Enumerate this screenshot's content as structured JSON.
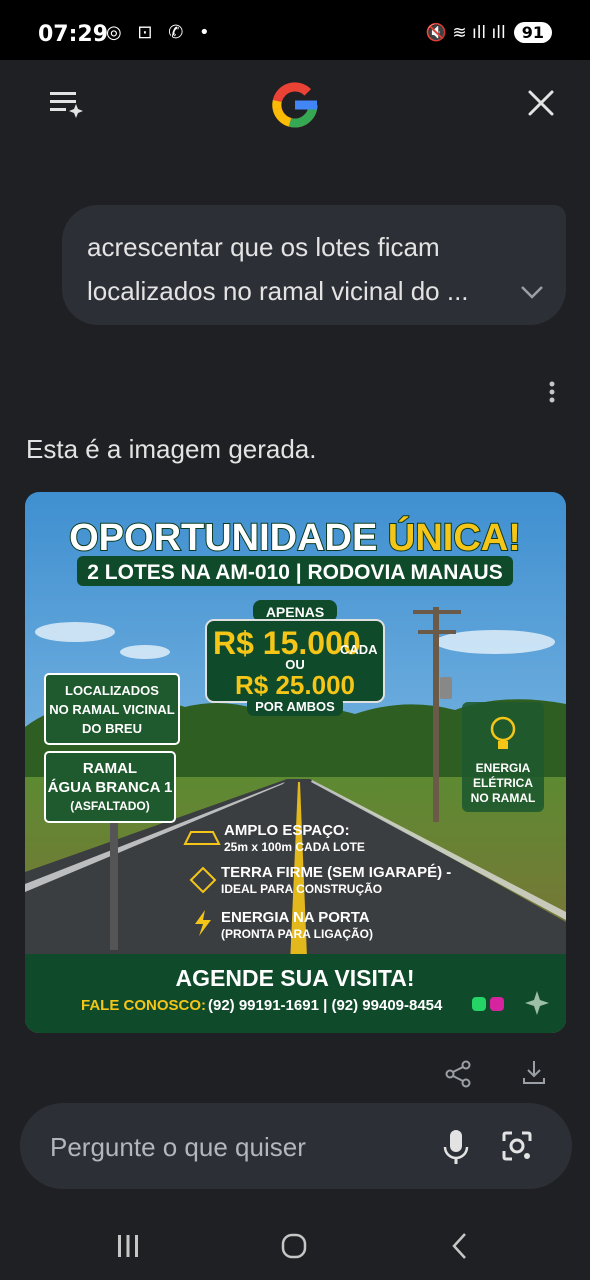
{
  "status_bar": {
    "time": "07:29",
    "left_icons": [
      "chrome-icon",
      "screenshot-icon",
      "whatsapp-icon",
      "dot-icon"
    ],
    "left_glyphs": "◎ ⊡ ✆ •",
    "right_glyphs": "🔇 ≋ ıll ıll",
    "battery": "91"
  },
  "header": {
    "menu_icon": "history-menu-icon",
    "logo": "google-logo",
    "close_icon": "close-icon"
  },
  "user_message": {
    "line1": "acrescentar que os lotes ficam",
    "line2": "localizados no ramal vicinal do ..."
  },
  "response": {
    "text": "Esta é a imagem gerada."
  },
  "generated_image": {
    "title_part1": "OPORTUNIDADE",
    "title_part2": "ÚNICA!",
    "subtitle": "2 LOTES NA AM-010 | RODOVIA MANAUS",
    "price_label_top": "APENAS",
    "price_main": "R$ 15.000",
    "price_main_suffix": "CADA",
    "price_or": "OU",
    "price_both": "R$ 25.000",
    "price_both_label": "POR AMBOS",
    "sign_location": [
      "LOCALIZADOS",
      "NO RAMAL VICINAL",
      "DO BREU"
    ],
    "sign_ramal": [
      "RAMAL",
      "ÁGUA BRANCA 1",
      "(ASFALTADO)"
    ],
    "energy_sign": [
      "ENERGIA",
      "ELÉTRICA",
      "NO RAMAL"
    ],
    "features": [
      {
        "title": "AMPLO ESPAÇO:",
        "detail": "25m x 100m CADA LOTE"
      },
      {
        "title": "TERRA FIRME (SEM IGARAPÉ) -",
        "detail": "IDEAL PARA CONSTRUÇÃO"
      },
      {
        "title": "ENERGIA NA PORTA",
        "detail": "(PRONTA PARA LIGAÇÃO)"
      }
    ],
    "cta": "AGENDE SUA VISITA!",
    "contact_label": "FALE CONOSCO:",
    "contact_numbers": "(92) 99191-1691 | (92) 99409-8454",
    "colors": {
      "sky": "#5aa7dc",
      "dark_green": "#0f4a2a",
      "yellow": "#f5c518",
      "road": "#3b3e41"
    }
  },
  "actions": {
    "share_icon": "share-icon",
    "download_icon": "download-icon"
  },
  "input": {
    "placeholder": "Pergunte o que quiser",
    "mic_icon": "microphone-icon",
    "lens_icon": "google-lens-icon"
  },
  "nav": {
    "recent_icon": "recent-apps-icon",
    "home_icon": "home-icon",
    "back_icon": "back-icon"
  }
}
